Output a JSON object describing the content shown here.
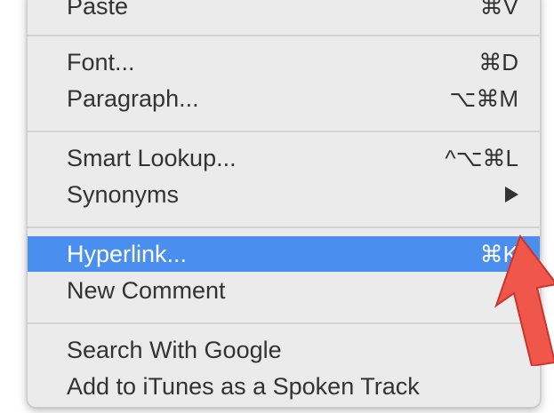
{
  "menu": {
    "items": [
      {
        "label": "Paste",
        "shortcut": "⌘V"
      },
      {
        "label": "Font...",
        "shortcut": "⌘D"
      },
      {
        "label": "Paragraph...",
        "shortcut": "⌥⌘M"
      },
      {
        "label": "Smart Lookup...",
        "shortcut": "^⌥⌘L"
      },
      {
        "label": "Synonyms",
        "shortcut": ""
      },
      {
        "label": "Hyperlink...",
        "shortcut": "⌘K",
        "highlighted": true
      },
      {
        "label": "New Comment",
        "shortcut": ""
      },
      {
        "label": "Search With Google",
        "shortcut": ""
      },
      {
        "label": "Add to iTunes as a Spoken Track",
        "shortcut": ""
      }
    ]
  },
  "colors": {
    "menu_background": "#ebebeb",
    "highlight": "#4a8ff0",
    "annotation_arrow": "#f0564a"
  },
  "icons": {
    "submenu": "triangle-right-icon",
    "annotation": "red-pointer-arrow-icon"
  }
}
